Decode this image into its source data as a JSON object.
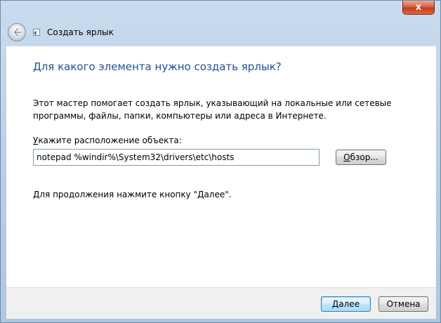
{
  "window": {
    "close_glyph": "x",
    "title": "Создать ярлык"
  },
  "page": {
    "main_instruction": "Для какого элемента нужно создать ярлык?",
    "description": "Этот мастер помогает создать ярлык, указывающий на локальные или сетевые программы, файлы, папки, компьютеры или адреса в Интернете.",
    "location_label_accel": "У",
    "location_label_rest": "кажите расположение объекта:",
    "location_value": "notepad %windir%\\System32\\drivers\\etc\\hosts",
    "browse_label_accel": "О",
    "browse_label_rest": "бзор...",
    "hint": "Для продолжения нажмите кнопку \"Далее\"."
  },
  "footer": {
    "next_label": "Далее",
    "cancel_label": "Отмена"
  },
  "icons": {
    "back": "back-arrow-icon",
    "wizard": "shortcut-icon",
    "close": "close-icon"
  },
  "colors": {
    "instruction": "#1f4f9e",
    "close_button": "#c63a17",
    "default_button_border": "#3c7fb1"
  }
}
